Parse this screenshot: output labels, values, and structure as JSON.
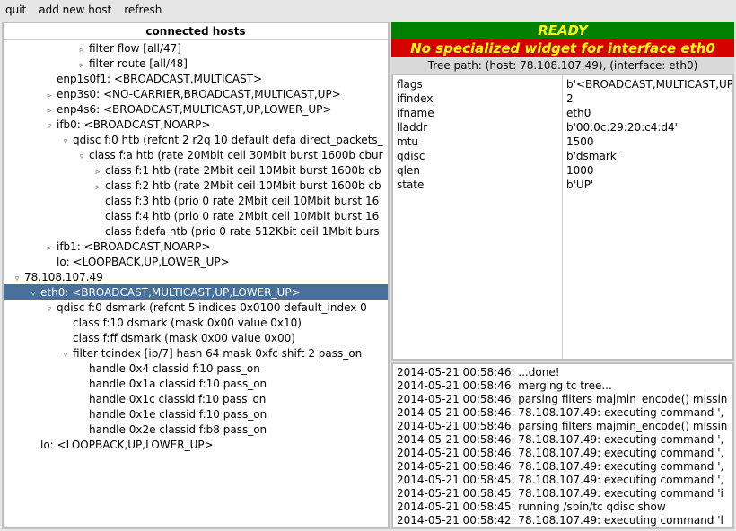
{
  "menu": {
    "quit": "quit",
    "add_new_host": "add new host",
    "refresh": "refresh"
  },
  "left": {
    "header": "connected hosts",
    "rows": [
      {
        "indent": 4,
        "expander": "▹",
        "text": "filter flow [all/47]",
        "selected": false
      },
      {
        "indent": 4,
        "expander": "▹",
        "text": "filter route [all/48]",
        "selected": false
      },
      {
        "indent": 2,
        "expander": "",
        "text": "enp1s0f1: <BROADCAST,MULTICAST>",
        "selected": false
      },
      {
        "indent": 2,
        "expander": "▹",
        "text": "enp3s0: <NO-CARRIER,BROADCAST,MULTICAST,UP>",
        "selected": false
      },
      {
        "indent": 2,
        "expander": "▹",
        "text": "enp4s6: <BROADCAST,MULTICAST,UP,LOWER_UP>",
        "selected": false
      },
      {
        "indent": 2,
        "expander": "▿",
        "text": "ifb0: <BROADCAST,NOARP>",
        "selected": false
      },
      {
        "indent": 3,
        "expander": "▿",
        "text": "qdisc f:0 htb (refcnt 2 r2q 10 default defa direct_packets_",
        "selected": false
      },
      {
        "indent": 4,
        "expander": "▿",
        "text": "class f:a htb (rate 20Mbit ceil 30Mbit burst 1600b cbur",
        "selected": false
      },
      {
        "indent": 5,
        "expander": "▹",
        "text": "class f:1 htb (rate 2Mbit ceil 10Mbit burst 1600b cb",
        "selected": false
      },
      {
        "indent": 5,
        "expander": "▹",
        "text": "class f:2 htb (rate 2Mbit ceil 10Mbit burst 1600b cb",
        "selected": false
      },
      {
        "indent": 5,
        "expander": "",
        "text": "class f:3 htb (prio 0 rate 2Mbit ceil 10Mbit burst 16",
        "selected": false
      },
      {
        "indent": 5,
        "expander": "",
        "text": "class f:4 htb (prio 0 rate 2Mbit ceil 10Mbit burst 16",
        "selected": false
      },
      {
        "indent": 5,
        "expander": "",
        "text": "class f:defa htb (prio 0 rate 512Kbit ceil 1Mbit burs",
        "selected": false
      },
      {
        "indent": 2,
        "expander": "▹",
        "text": "ifb1: <BROADCAST,NOARP>",
        "selected": false
      },
      {
        "indent": 2,
        "expander": "",
        "text": "lo: <LOOPBACK,UP,LOWER_UP>",
        "selected": false
      },
      {
        "indent": 0,
        "expander": "▿",
        "text": "78.108.107.49",
        "selected": false
      },
      {
        "indent": 1,
        "expander": "▿",
        "text": "eth0: <BROADCAST,MULTICAST,UP,LOWER_UP>",
        "selected": true
      },
      {
        "indent": 2,
        "expander": "▿",
        "text": "qdisc f:0 dsmark (refcnt 5 indices 0x0100 default_index 0",
        "selected": false
      },
      {
        "indent": 3,
        "expander": "",
        "text": "class f:10 dsmark (mask 0x00 value 0x10)",
        "selected": false
      },
      {
        "indent": 3,
        "expander": "",
        "text": "class f:ff dsmark (mask 0x00 value 0x00)",
        "selected": false
      },
      {
        "indent": 3,
        "expander": "▿",
        "text": "filter tcindex [ip/7] hash 64 mask 0xfc shift 2 pass_on",
        "selected": false
      },
      {
        "indent": 4,
        "expander": "",
        "text": "handle 0x4 classid f:10 pass_on",
        "selected": false
      },
      {
        "indent": 4,
        "expander": "",
        "text": "handle 0x1a classid f:10 pass_on",
        "selected": false
      },
      {
        "indent": 4,
        "expander": "",
        "text": "handle 0x1c classid f:10 pass_on",
        "selected": false
      },
      {
        "indent": 4,
        "expander": "",
        "text": "handle 0x1e classid f:10 pass_on",
        "selected": false
      },
      {
        "indent": 4,
        "expander": "",
        "text": "handle 0x2e classid f:b8 pass_on",
        "selected": false
      },
      {
        "indent": 1,
        "expander": "",
        "text": "lo: <LOOPBACK,UP,LOWER_UP>",
        "selected": false
      }
    ]
  },
  "right": {
    "ready": "READY",
    "nospec": "No specialized widget for interface eth0",
    "treepath": "Tree path: (host: 78.108.107.49), (interface: eth0)",
    "props_keys": [
      "flags",
      "ifindex",
      "ifname",
      "lladdr",
      "mtu",
      "qdisc",
      "qlen",
      "state"
    ],
    "props_vals": [
      "b'<BROADCAST,MULTICAST,UP,L",
      "2",
      "eth0",
      "b'00:0c:29:20:c4:d4'",
      "1500",
      "b'dsmark'",
      "1000",
      "b'UP'"
    ],
    "log": [
      "2014-05-21 00:58:46: ...done!",
      "2014-05-21 00:58:46: merging tc tree...",
      "2014-05-21 00:58:46: parsing filters majmin_encode() missin",
      "2014-05-21 00:58:46: 78.108.107.49: executing command ',",
      "2014-05-21 00:58:46: parsing filters majmin_encode() missin",
      "2014-05-21 00:58:46: 78.108.107.49: executing command ',",
      "2014-05-21 00:58:46: 78.108.107.49: executing command ',",
      "2014-05-21 00:58:46: 78.108.107.49: executing command ',",
      "2014-05-21 00:58:45: 78.108.107.49: executing command ',",
      "2014-05-21 00:58:45: 78.108.107.49: executing command 'i",
      "2014-05-21 00:58:45: running /sbin/tc qdisc show",
      "2014-05-21 00:58:42: 78.108.107.49: executing command 'l"
    ]
  }
}
